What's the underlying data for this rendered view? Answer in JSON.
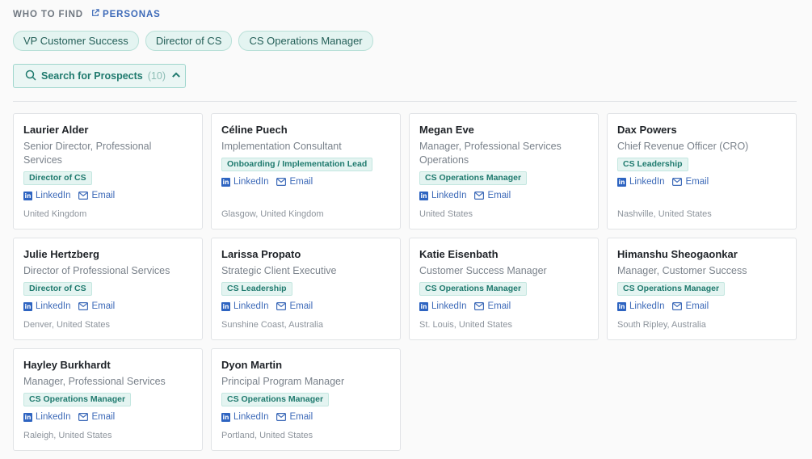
{
  "header": {
    "section_title": "WHO TO FIND",
    "personas_link": "PERSONAS"
  },
  "chips": [
    "VP Customer Success",
    "Director of CS",
    "CS Operations Manager"
  ],
  "search": {
    "label": "Search for Prospects",
    "count": "(10)"
  },
  "link_labels": {
    "linkedin": "LinkedIn",
    "email": "Email"
  },
  "prospects": [
    {
      "name": "Laurier Alder",
      "title": "Senior Director, Professional Services",
      "badge": "Director of CS",
      "location": "United Kingdom"
    },
    {
      "name": "Céline Puech",
      "title": "Implementation Consultant",
      "badge": "Onboarding / Implementation Lead",
      "location": "Glasgow, United Kingdom"
    },
    {
      "name": "Megan Eve",
      "title": "Manager, Professional Services Operations",
      "badge": "CS Operations Manager",
      "location": "United States"
    },
    {
      "name": "Dax Powers",
      "title": "Chief Revenue Officer (CRO)",
      "badge": "CS Leadership",
      "location": "Nashville, United States"
    },
    {
      "name": "Julie Hertzberg",
      "title": "Director of Professional Services",
      "badge": "Director of CS",
      "location": "Denver, United States"
    },
    {
      "name": "Larissa Propato",
      "title": "Strategic Client Executive",
      "badge": "CS Leadership",
      "location": "Sunshine Coast, Australia"
    },
    {
      "name": "Katie Eisenbath",
      "title": "Customer Success Manager",
      "badge": "CS Operations Manager",
      "location": "St. Louis, United States"
    },
    {
      "name": "Himanshu Sheogaonkar",
      "title": "Manager, Customer Success",
      "badge": "CS Operations Manager",
      "location": "South Ripley, Australia"
    },
    {
      "name": "Hayley Burkhardt",
      "title": "Manager, Professional Services",
      "badge": "CS Operations Manager",
      "location": "Raleigh, United States"
    },
    {
      "name": "Dyon Martin",
      "title": "Principal Program Manager",
      "badge": "CS Operations Manager",
      "location": "Portland, United States"
    }
  ]
}
